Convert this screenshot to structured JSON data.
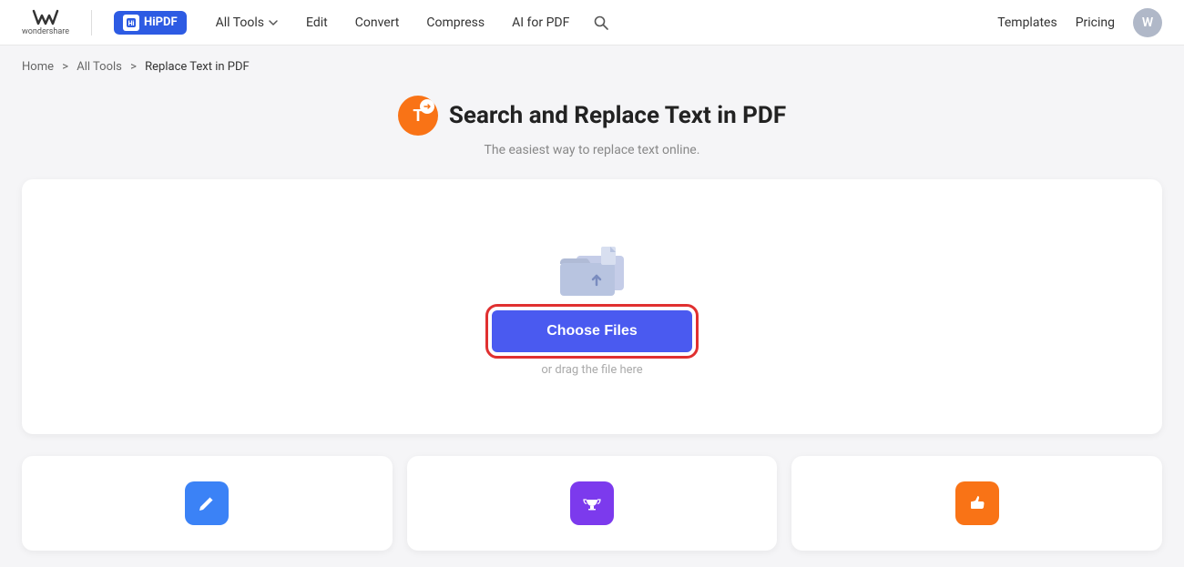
{
  "header": {
    "wondershare_label": "wondershare",
    "hipdf_label": "HiPDF",
    "nav_items": [
      {
        "label": "All Tools",
        "has_dropdown": true
      },
      {
        "label": "Edit"
      },
      {
        "label": "Convert"
      },
      {
        "label": "Compress"
      },
      {
        "label": "AI for PDF"
      }
    ],
    "right_links": [
      "Templates",
      "Pricing"
    ],
    "avatar_letter": "W"
  },
  "breadcrumb": {
    "items": [
      "Home",
      "All Tools",
      "Replace Text in PDF"
    ]
  },
  "page": {
    "title": "Search and Replace Text in PDF",
    "subtitle": "The easiest way to replace text online.",
    "icon_label": "replace-text-icon"
  },
  "upload": {
    "choose_files_label": "Choose Files",
    "drag_hint": "or drag the file here"
  },
  "bottom_cards": [
    {
      "icon_unicode": "✏",
      "color_class": "icon-blue"
    },
    {
      "icon_unicode": "🏆",
      "color_class": "icon-purple"
    },
    {
      "icon_unicode": "👍",
      "color_class": "icon-orange"
    }
  ],
  "colors": {
    "accent": "#4a5af0",
    "highlight_outline": "#e03030",
    "nav_active": "#2d5be3"
  }
}
